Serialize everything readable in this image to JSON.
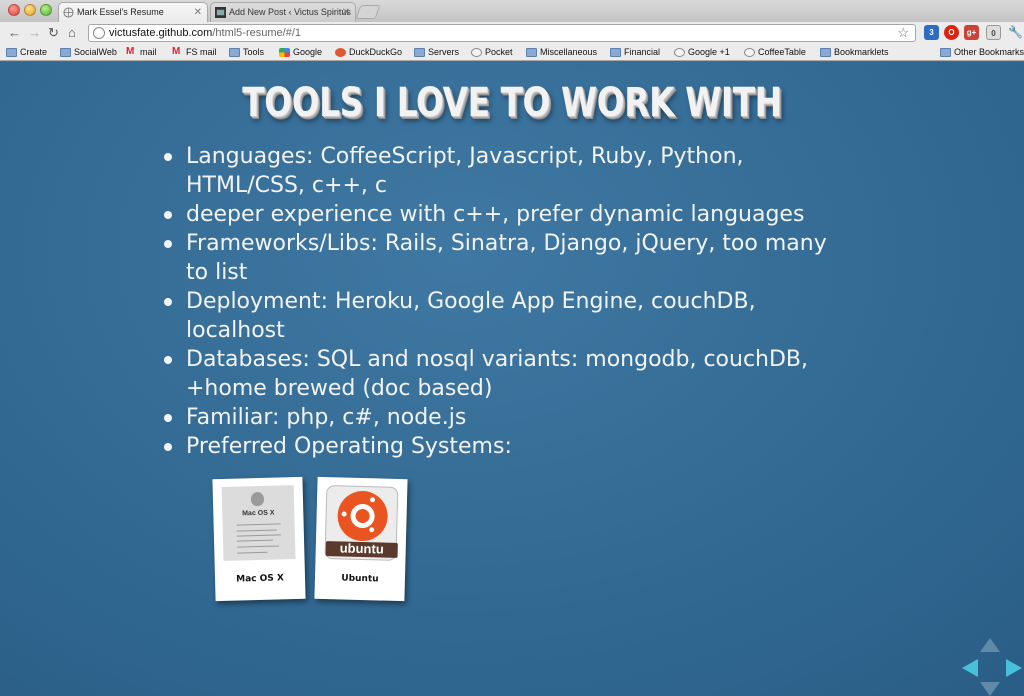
{
  "browser": {
    "tabs": [
      {
        "label": "Mark Essel's Resume"
      },
      {
        "label": "Add New Post ‹ Victus Spiritus"
      }
    ],
    "url_host": "victusfate.github.com",
    "url_path": "/html5-resume/#/1",
    "extension_badge_1": "3",
    "extension_badge_2": "0",
    "bookmarks": [
      "Create",
      "SocialWeb",
      "mail",
      "FS mail",
      "Tools",
      "Google",
      "DuckDuckGo",
      "Servers",
      "Pocket",
      "Miscellaneous",
      "Financial",
      "Google +1",
      "CoffeeTable",
      "Bookmarklets"
    ],
    "other_bookmarks": "Other Bookmarks"
  },
  "slide": {
    "title": "TOOLS I LOVE TO WORK WITH",
    "bullets": [
      "Languages: CoffeeScript, Javascript, Ruby, Python, HTML/CSS, c++, c",
      "deeper experience with c++, prefer dynamic languages",
      "Frameworks/Libs: Rails, Sinatra, Django, jQuery, too many to list",
      "Deployment: Heroku, Google App Engine, couchDB, localhost",
      "Databases: SQL and nosql variants: mongodb, couchDB, +home brewed (doc based)",
      "Familiar: php, c#, node.js",
      "Preferred Operating Systems:"
    ],
    "os": [
      {
        "caption": "Mac OS X",
        "photo_title": "Mac OS X"
      },
      {
        "caption": "Ubuntu",
        "logo_text": "ubuntu"
      }
    ]
  },
  "colors": {
    "page_background": "#3a6f97",
    "nav_arrow_active": "#48c0dc",
    "ubuntu_orange": "#e95420"
  }
}
